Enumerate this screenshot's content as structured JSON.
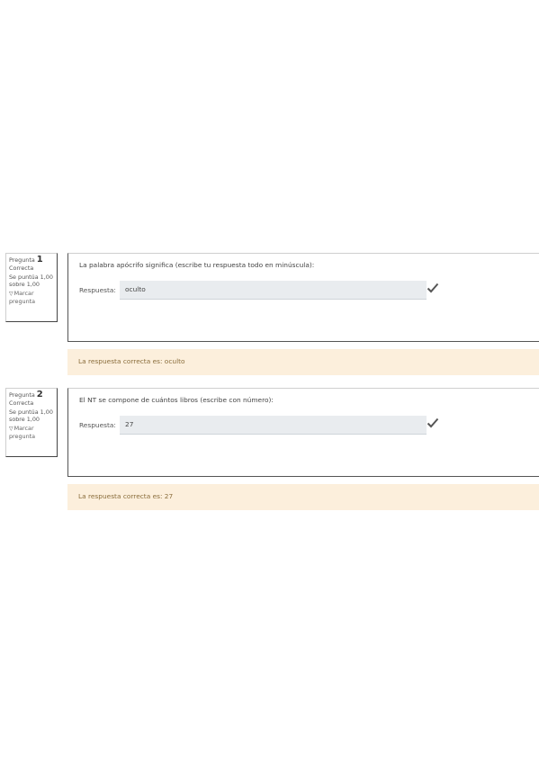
{
  "questions": [
    {
      "number_label": "Pregunta",
      "number": "1",
      "state": "Correcta",
      "grade": "Se puntúa 1,00 sobre 1,00",
      "flag_label": "Marcar pregunta",
      "question_text": "La palabra apócrifo significa (escribe tu respuesta todo en minúscula):",
      "answer_label": "Respuesta:",
      "answer_value": "oculto",
      "feedback": "La respuesta correcta es: oculto"
    },
    {
      "number_label": "Pregunta",
      "number": "2",
      "state": "Correcta",
      "grade": "Se puntúa 1,00 sobre 1,00",
      "flag_label": "Marcar pregunta",
      "question_text": "El NT se compone de cuántos libros (escribe con número):",
      "answer_label": "Respuesta:",
      "answer_value": "27",
      "feedback": "La respuesta correcta es: 27"
    }
  ],
  "icons": {
    "correct": "check-icon",
    "flag": "flag-icon"
  },
  "colors": {
    "feedback_bg": "#fcefdc",
    "feedback_text": "#8a6d3b",
    "input_bg": "#e9ecef",
    "check": "#555555"
  }
}
